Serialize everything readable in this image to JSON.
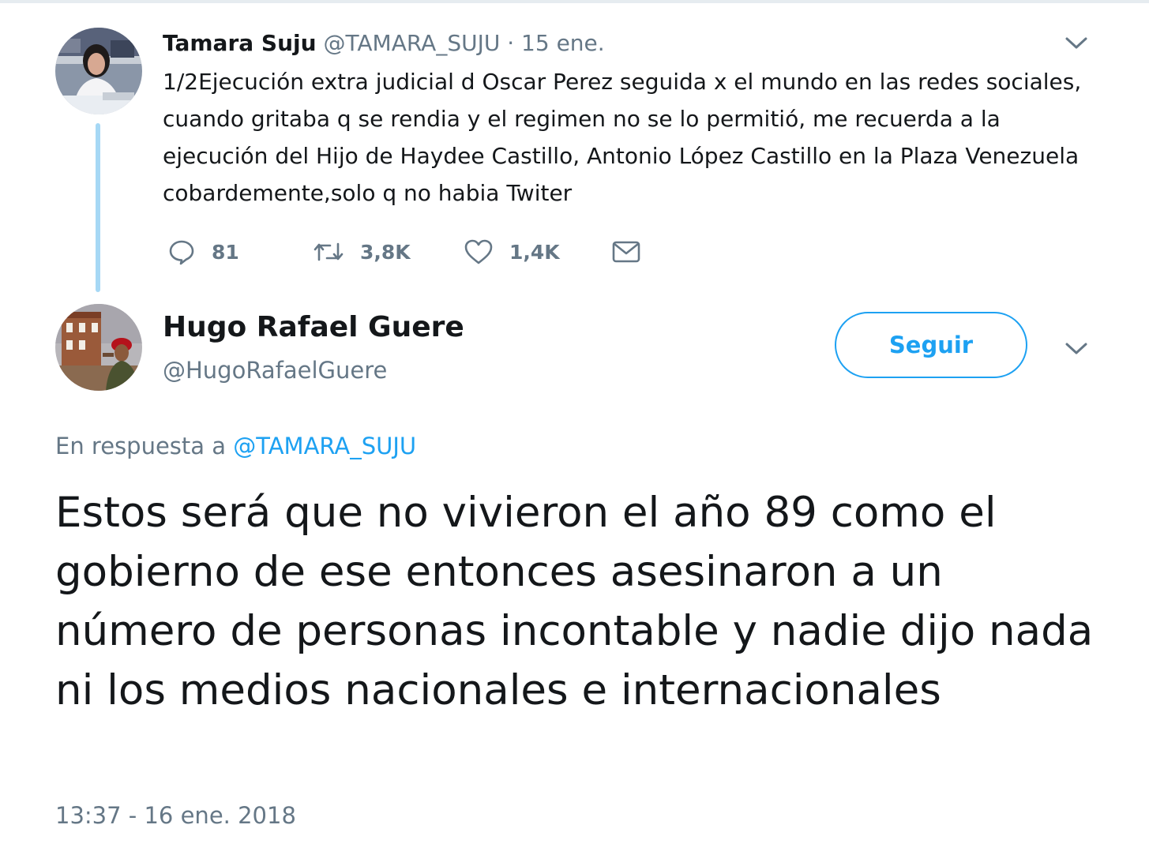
{
  "parent_tweet": {
    "author_name": "Tamara Suju",
    "author_handle": "@TAMARA_SUJU",
    "separator": " · ",
    "date": "15 ene.",
    "text": "1/2Ejecución extra judicial d Oscar Perez seguida x el mundo en las redes sociales, cuando gritaba q se rendia y el regimen no se lo permitió, me recuerda a la ejecución del Hijo de Haydee Castillo, Antonio López Castillo en la Plaza Venezuela cobardemente,solo q no habia Twiter",
    "actions": {
      "reply_count": "81",
      "retweet_count": "3,8K",
      "like_count": "1,4K"
    }
  },
  "reply_tweet": {
    "author_name": "Hugo Rafael Guere",
    "author_handle": "@HugoRafaelGuere",
    "follow_label": "Seguir",
    "reply_to_prefix": "En respuesta a ",
    "reply_to_handle": "@TAMARA_SUJU",
    "text": "Estos será que no vivieron el año 89 como el gobierno de ese entonces asesinaron a un número de personas incontable y nadie dijo nada ni los medios nacionales e internacionales",
    "timestamp": "13:37 - 16 ene. 2018"
  },
  "icons": {
    "reply": "reply-icon",
    "retweet": "retweet-icon",
    "like": "heart-icon",
    "dm": "envelope-icon",
    "menu": "chevron-down-icon"
  },
  "colors": {
    "accent": "#1da1f2",
    "secondary_text": "#657786",
    "primary_text": "#14171a",
    "thread_line": "#a6d8f5"
  }
}
